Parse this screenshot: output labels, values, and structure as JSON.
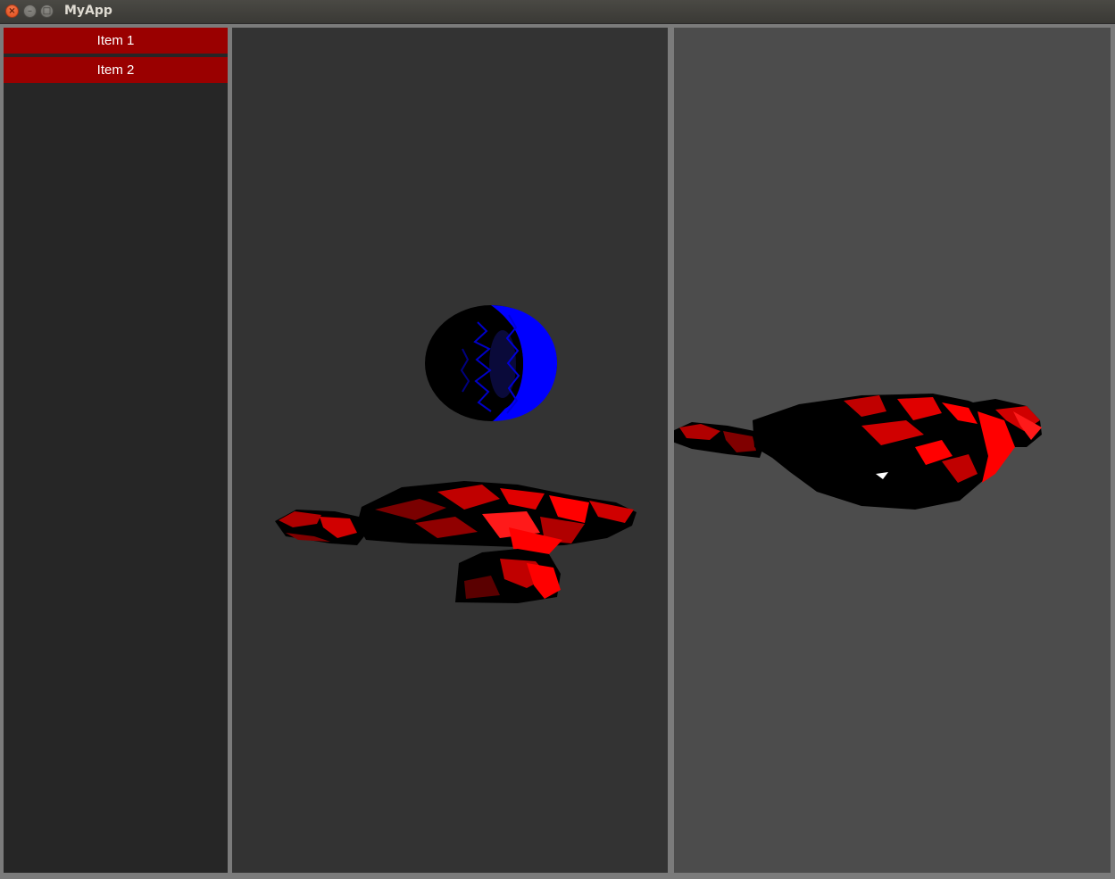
{
  "window": {
    "title": "MyApp",
    "close_glyph": "×",
    "minimize_glyph": "–",
    "maximize_glyph": "□"
  },
  "sidebar": {
    "items": [
      {
        "label": "Item 1"
      },
      {
        "label": "Item 2"
      }
    ]
  },
  "colors": {
    "accent_item": "#9a0000",
    "mesh_red": "#ff0000",
    "mesh_blue": "#0000ff",
    "viewport_left_bg": "#333333",
    "viewport_right_bg": "#4c4c4c",
    "sidebar_bg": "#262626"
  },
  "viewports": [
    {
      "name": "left-3d-viewport",
      "objects": [
        "blue torus mesh",
        "red monkey mesh"
      ]
    },
    {
      "name": "right-3d-viewport",
      "objects": [
        "red monkey mesh (top view)"
      ]
    }
  ]
}
